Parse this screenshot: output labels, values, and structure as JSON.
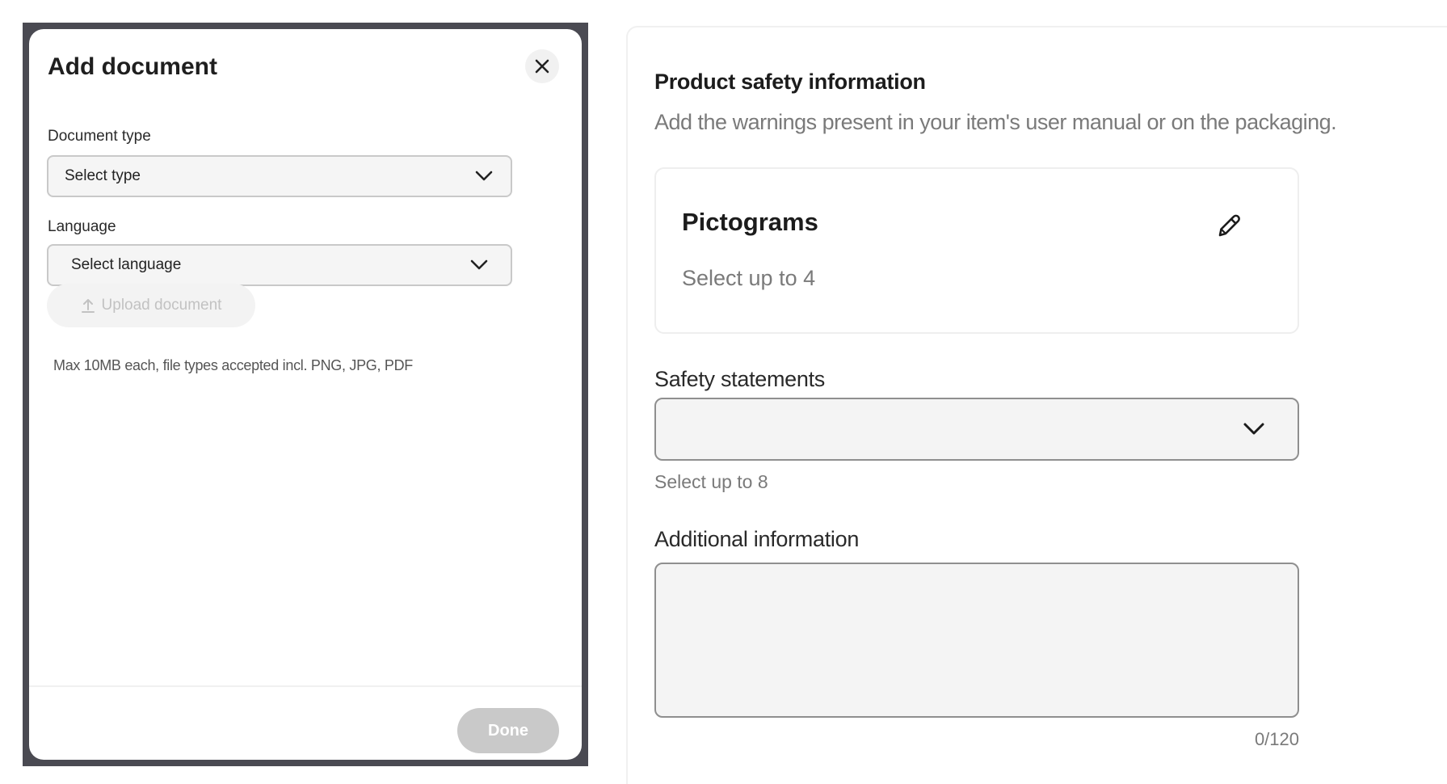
{
  "modal": {
    "title": "Add document",
    "document_type": {
      "label": "Document type",
      "selected": "Select type"
    },
    "language": {
      "label": "Language",
      "selected": "Select language"
    },
    "upload_button": "Upload document",
    "file_hint": "Max 10MB each, file types accepted incl. PNG, JPG, PDF",
    "done_button": "Done"
  },
  "safety": {
    "title": "Product safety information",
    "subtitle": "Add the warnings present in your item's user manual or on the packaging.",
    "pictograms": {
      "title": "Pictograms",
      "subtitle": "Select up to 4"
    },
    "statements": {
      "label": "Safety statements",
      "value": "",
      "hint": "Select up to 8"
    },
    "additional": {
      "label": "Additional information",
      "value": "",
      "counter": "0/120"
    }
  },
  "icons": {
    "close": "close-icon",
    "chevron": "chevron-down-icon",
    "upload": "upload-icon",
    "edit": "pencil-icon"
  },
  "colors": {
    "disabled_button": "#c9c9c9",
    "modal_backdrop": "#4a4a52",
    "muted_text": "#7a7a7a"
  }
}
